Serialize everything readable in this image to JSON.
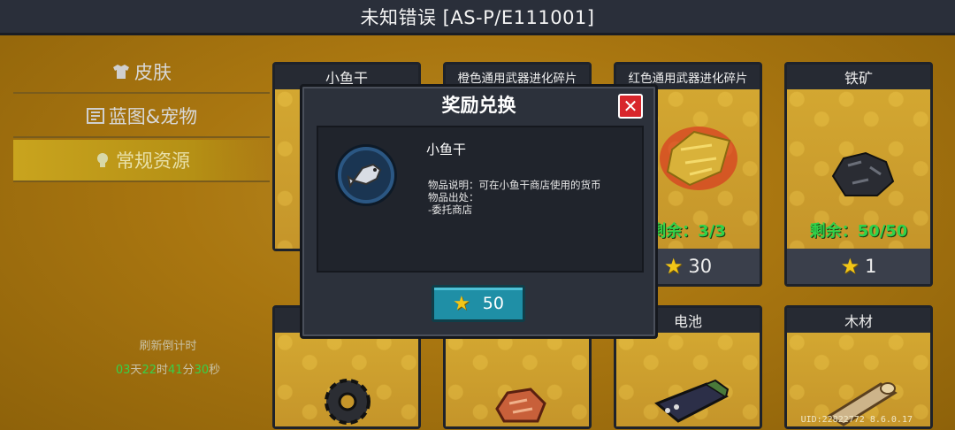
{
  "header": {
    "title": "未知错误 [AS-P/E111001]"
  },
  "sidebar": {
    "items": [
      {
        "label": "皮肤",
        "icon": "shirt-icon"
      },
      {
        "label": "蓝图&宠物",
        "icon": "blueprint-icon"
      },
      {
        "label": "常规资源",
        "icon": "resource-icon",
        "active": true
      }
    ]
  },
  "refresh": {
    "label": "刷新倒计时",
    "days": "03",
    "days_unit": "天",
    "hours": "22",
    "hours_unit": "时",
    "minutes": "41",
    "minutes_unit": "分",
    "seconds": "30",
    "seconds_unit": "秒"
  },
  "shop": {
    "cards": [
      {
        "name": "小鱼干",
        "remain": "",
        "price": ""
      },
      {
        "name": "橙色通用武器进化碎片",
        "remain": "",
        "price": ""
      },
      {
        "name": "红色通用武器进化碎片",
        "remain": "剩余：3/3",
        "price": "30"
      },
      {
        "name": "铁矿",
        "remain": "剩余：50/50",
        "price": "1"
      },
      {
        "name": "",
        "remain": "",
        "price": ""
      },
      {
        "name": "",
        "remain": "",
        "price": ""
      },
      {
        "name": "电池",
        "remain": "",
        "price": ""
      },
      {
        "name": "木材",
        "remain": "",
        "price": ""
      }
    ]
  },
  "modal": {
    "title": "奖励兑换",
    "item_name": "小鱼干",
    "desc_line1": "物品说明：可在小鱼干商店使用的货币",
    "desc_line2": "物品出处：",
    "desc_line3": "-委托商店",
    "buy_price": "50"
  },
  "footer": {
    "uid": "UID:22822772 8.6.0.17"
  },
  "colors": {
    "accent_gold": "#b07a12",
    "remain_green": "#2fd24a",
    "close_red": "#d8262c",
    "buy_teal": "#1f8fa6"
  }
}
